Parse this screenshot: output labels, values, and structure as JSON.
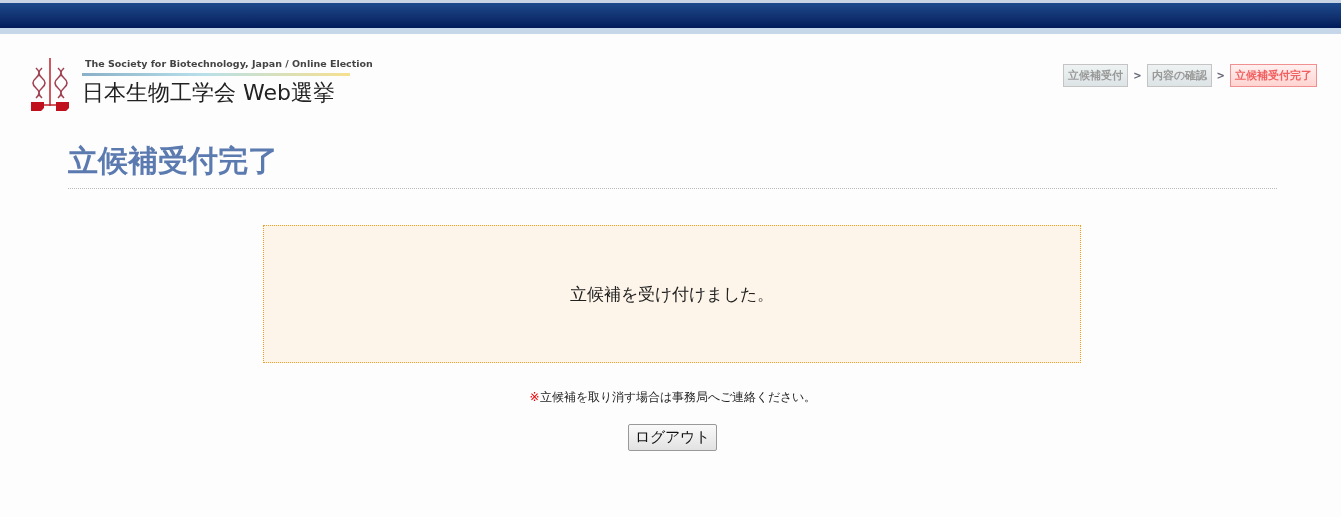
{
  "header": {
    "subtitle": "The Society for Biotechnology, Japan / Online Election",
    "title": "日本生物工学会 Web選挙"
  },
  "steps": [
    {
      "label": "立候補受付",
      "selected": false
    },
    {
      "label": "内容の確認",
      "selected": false
    },
    {
      "label": "立候補受付完了",
      "selected": true
    }
  ],
  "step_separator": ">",
  "page_title": "立候補受付完了",
  "message": "立候補を受け付けました。",
  "notice": {
    "mark": "※",
    "text": "立候補を取り消す場合は事務局へご連絡ください。"
  },
  "logout_button": "ログアウト"
}
